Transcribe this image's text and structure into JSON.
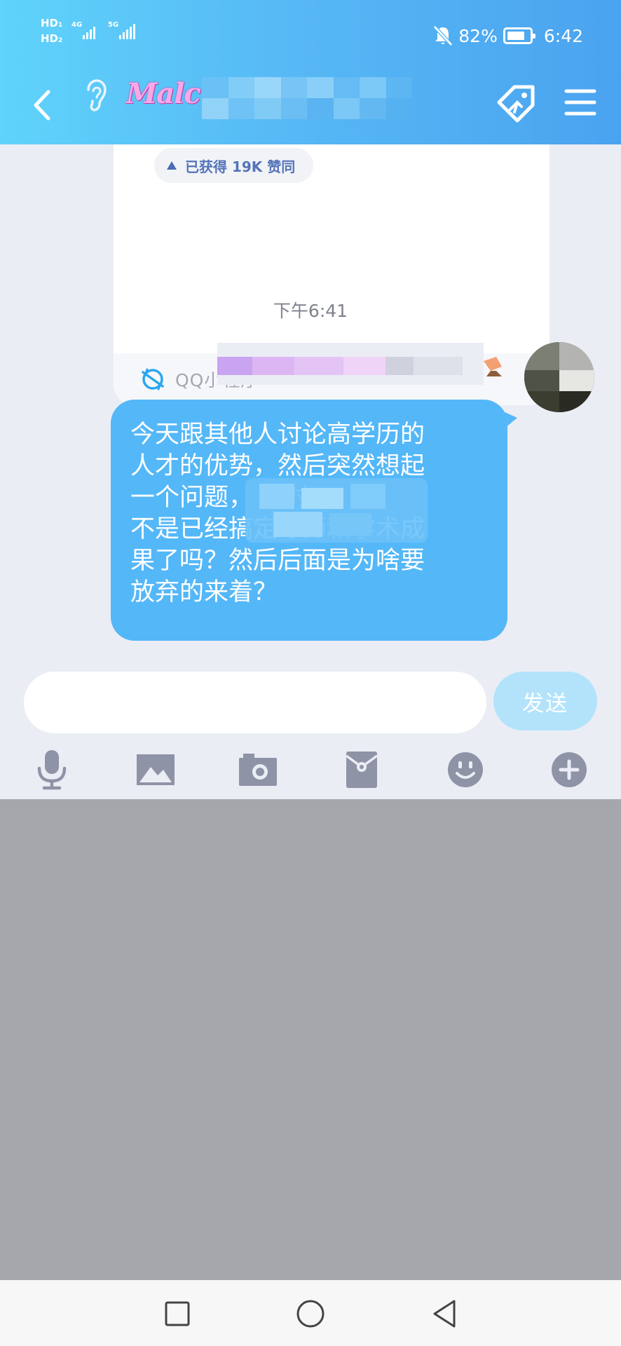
{
  "status_bar": {
    "sim1": "HD",
    "sim1_index": "1",
    "sim2": "HD",
    "sim2_index": "2",
    "network1": "4G",
    "network2": "5G",
    "battery_percent": "82%",
    "battery_level": 0.82,
    "time": "6:42"
  },
  "header": {
    "contact_name_visible": "Malc"
  },
  "mini_program_card": {
    "likes_text": "已获得 19K 赞同",
    "source_label": "QQ小程序"
  },
  "chat": {
    "timestamp": "下午6:41",
    "message_lines": [
      "今天跟其他人讨论高学历的",
      "人才的优势，然后突然想起",
      "一个问题，             当时",
      "不是已经搞定导师和学术成",
      "果了吗？然后后面是为啥要",
      "放弃的来着？"
    ]
  },
  "composer": {
    "input_value": "",
    "input_placeholder": "",
    "send_label": "发送"
  },
  "toolbar_icons": [
    "microphone-icon",
    "image-icon",
    "camera-icon",
    "red-packet-icon",
    "emoji-icon",
    "plus-icon"
  ],
  "colors": {
    "header_start": "#5fd3fb",
    "header_end": "#4aa3ef",
    "bubble": "#54b7f8",
    "chat_bg": "#ebedf5",
    "send_button": "#b3e3fb",
    "icon_gray": "#8e93a6"
  }
}
